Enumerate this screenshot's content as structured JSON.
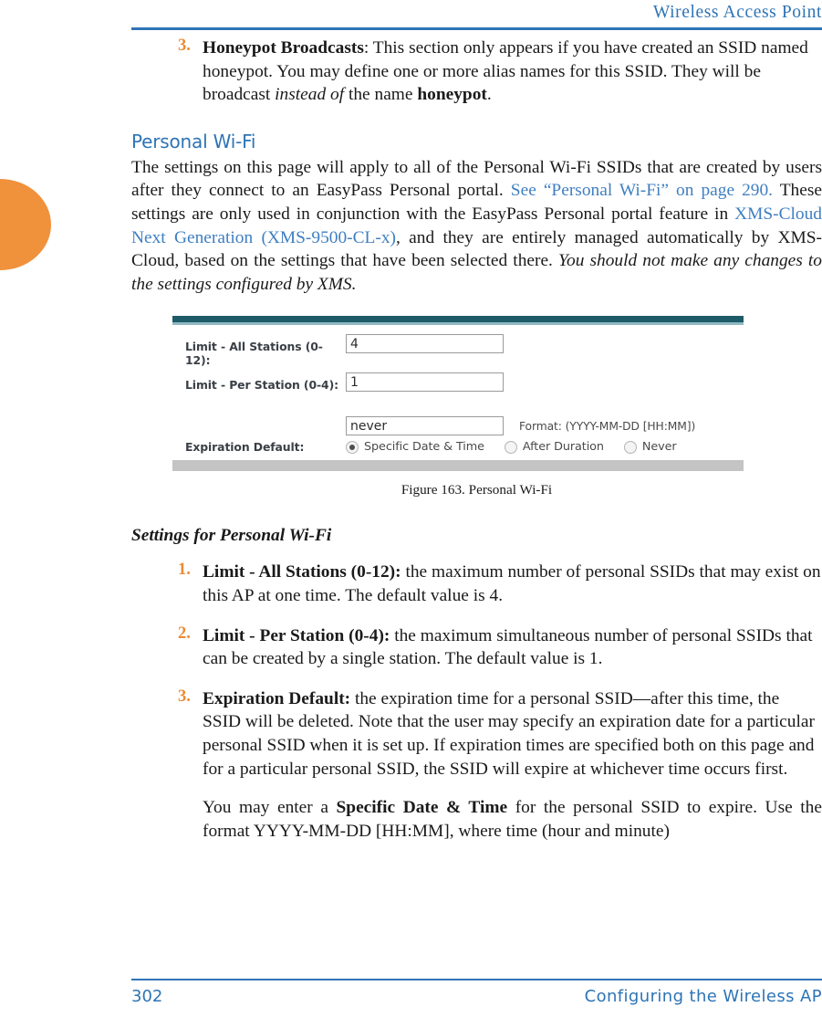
{
  "header": {
    "title": "Wireless Access Point"
  },
  "top_list": {
    "items": [
      {
        "marker": "3.",
        "lead": "Honeypot Broadcasts",
        "text_a": ": This section only appears if you have created an SSID named honeypot. You may define one or more alias names for this SSID. They will be broadcast ",
        "italic": "instead of",
        "text_b": " the name ",
        "bold_tail": "honeypot",
        "text_c": "."
      }
    ]
  },
  "section": {
    "heading": "Personal Wi-Fi",
    "intro_a": "The settings on this page will apply to all of the Personal Wi-Fi SSIDs that are created by users after they connect to an EasyPass Personal portal. ",
    "intro_link1": "See “Personal Wi-Fi” on page 290.",
    "intro_b": " These settings are only used in conjunction with the EasyPass Personal portal feature in ",
    "intro_link2": "XMS-Cloud Next Generation (XMS-9500-CL-x)",
    "intro_c": ", and they are entirely managed automatically by XMS-Cloud, based on the settings that have been selected there. ",
    "intro_italic": "You should not make any changes to the settings configured by XMS."
  },
  "figure": {
    "caption": "Figure 163. Personal Wi-Fi",
    "rows": [
      {
        "label": "Limit - All Stations (0-12):",
        "value": "4"
      },
      {
        "label": "Limit - Per Station (0-4):",
        "value": "1"
      }
    ],
    "expiration": {
      "label": "Expiration Default:",
      "value": "never",
      "format_hint": "Format: (YYYY-MM-DD [HH:MM])",
      "radios": [
        {
          "label": "Specific Date & Time",
          "selected": true
        },
        {
          "label": "After Duration",
          "selected": false
        },
        {
          "label": "Never",
          "selected": false
        }
      ]
    },
    "colors": {
      "topbar": "#1d5b68",
      "topbar_accent": "#8fb9c2",
      "bottombar": "#c4c4c4"
    }
  },
  "settings": {
    "heading": "Settings for Personal Wi-Fi",
    "items": [
      {
        "marker": "1.",
        "lead": "Limit - All Stations (0-12):",
        "text": " the maximum number of personal SSIDs that may exist on this AP at one time. The default value is 4."
      },
      {
        "marker": "2.",
        "lead": "Limit - Per Station (0-4):",
        "text": " the maximum simultaneous number of personal SSIDs that can be created by a single station. The default value is 1."
      },
      {
        "marker": "3.",
        "lead": "Expiration Default:",
        "text": " the expiration time for a personal SSID—after this time, the SSID will be deleted. Note that the user may specify an expiration date for a particular personal SSID when it is set up. If expiration times are specified both on this page and for a particular personal SSID, the SSID will expire at whichever time occurs first."
      }
    ],
    "sub_paragraph": {
      "text_a": "You may enter a ",
      "bold": "Specific Date & Time",
      "text_b": " for the personal SSID to expire. Use the format YYYY-MM-DD [HH:MM], where time (hour and minute)"
    }
  },
  "footer": {
    "page_number": "302",
    "section_title": "Configuring the Wireless AP"
  },
  "accents": {
    "brand_blue": "#2e74b5",
    "link_blue": "#3f7fc1",
    "marker_orange": "#ed8b33",
    "thumb_orange": "#f0913c"
  }
}
